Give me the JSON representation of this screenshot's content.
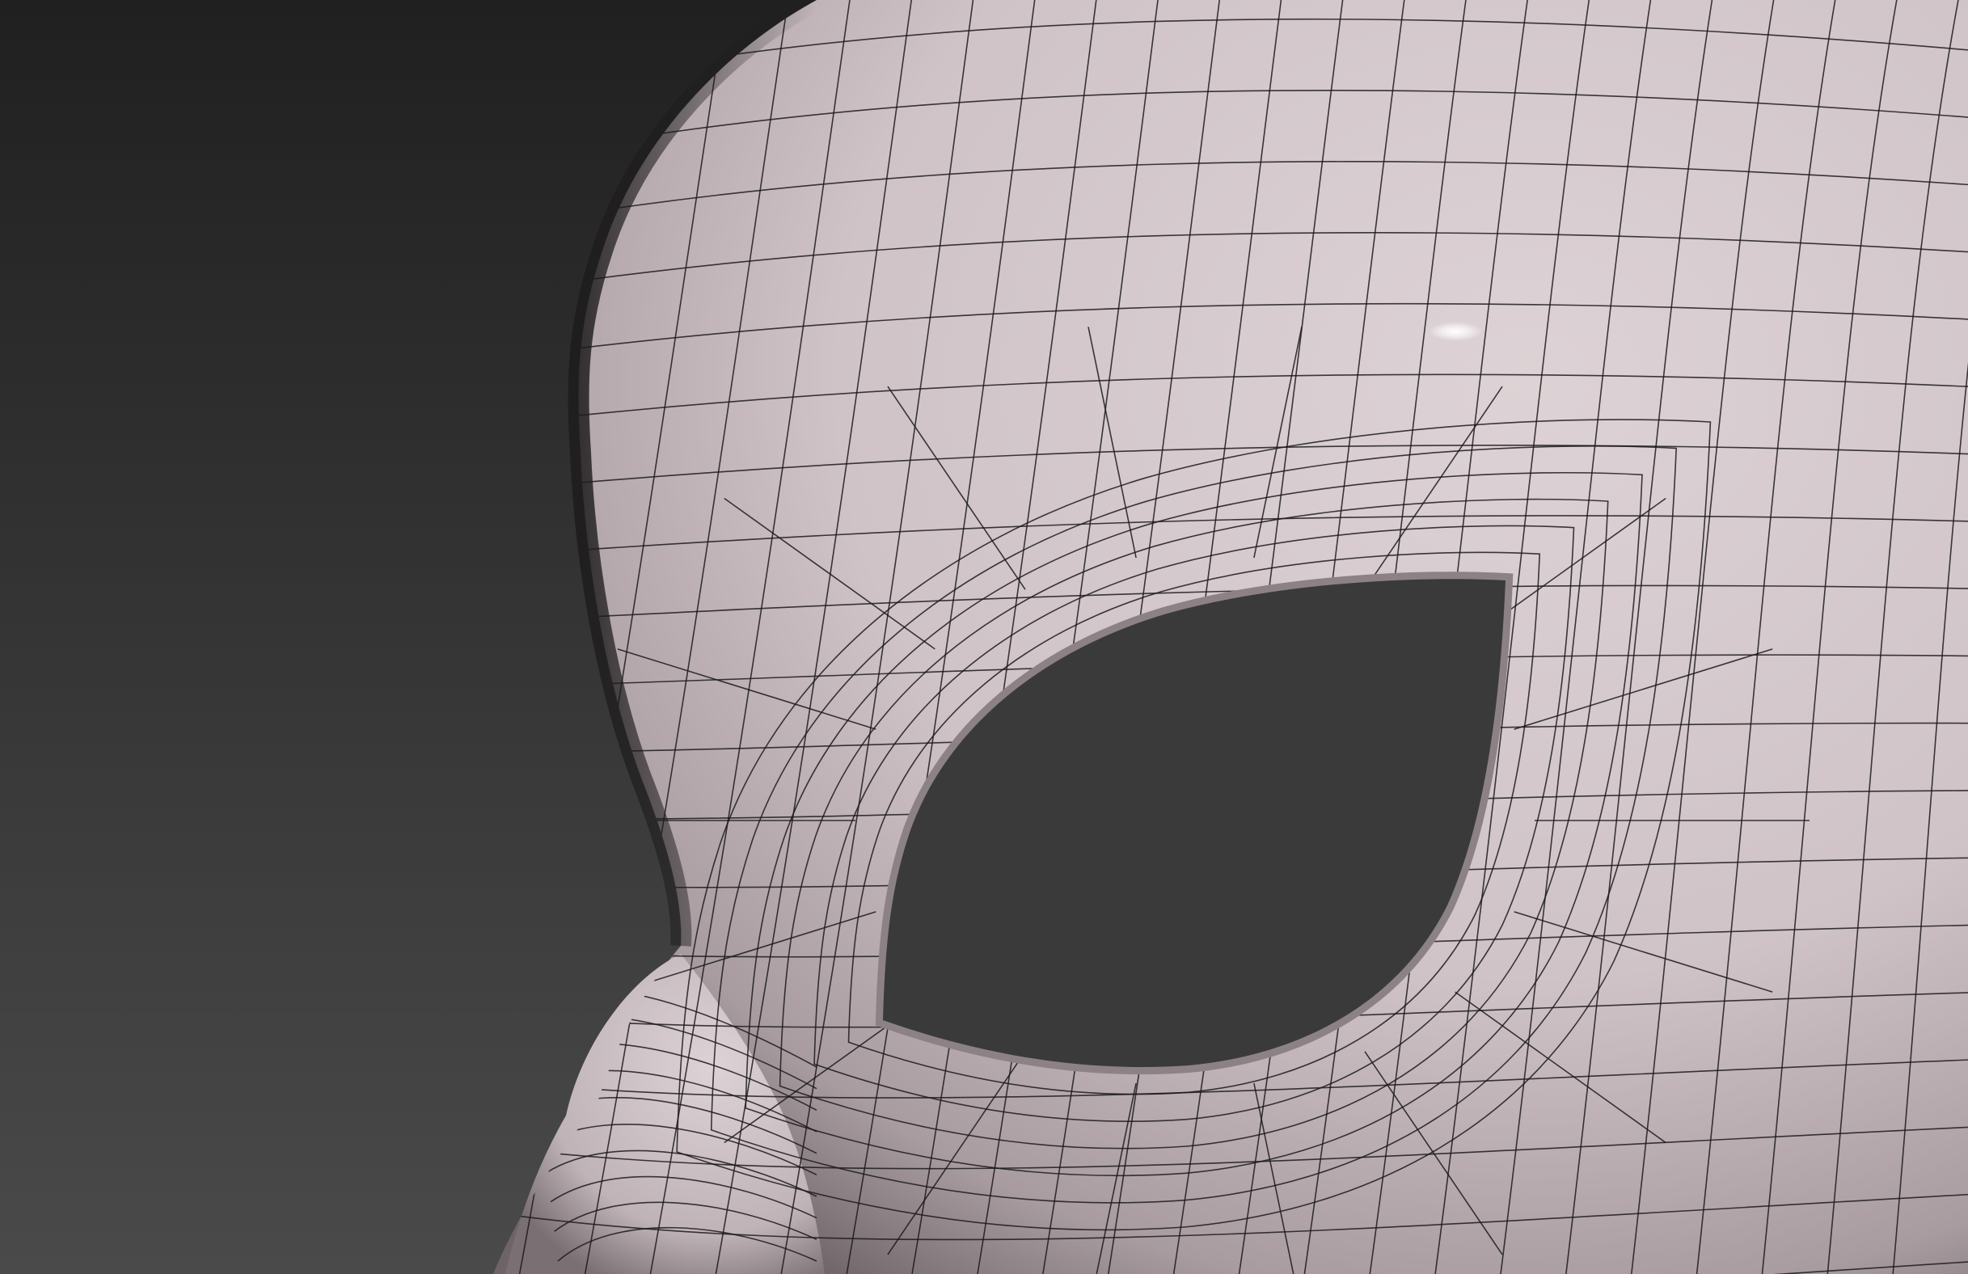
{
  "viewport": {
    "background_top": "#202020",
    "background_bottom": "#4a4a4a",
    "mesh_color": "#d8ccd0",
    "mesh_shadow": "#7e7478",
    "wire_color": "#1c1a1b",
    "highlight_color": "#ffffff"
  }
}
